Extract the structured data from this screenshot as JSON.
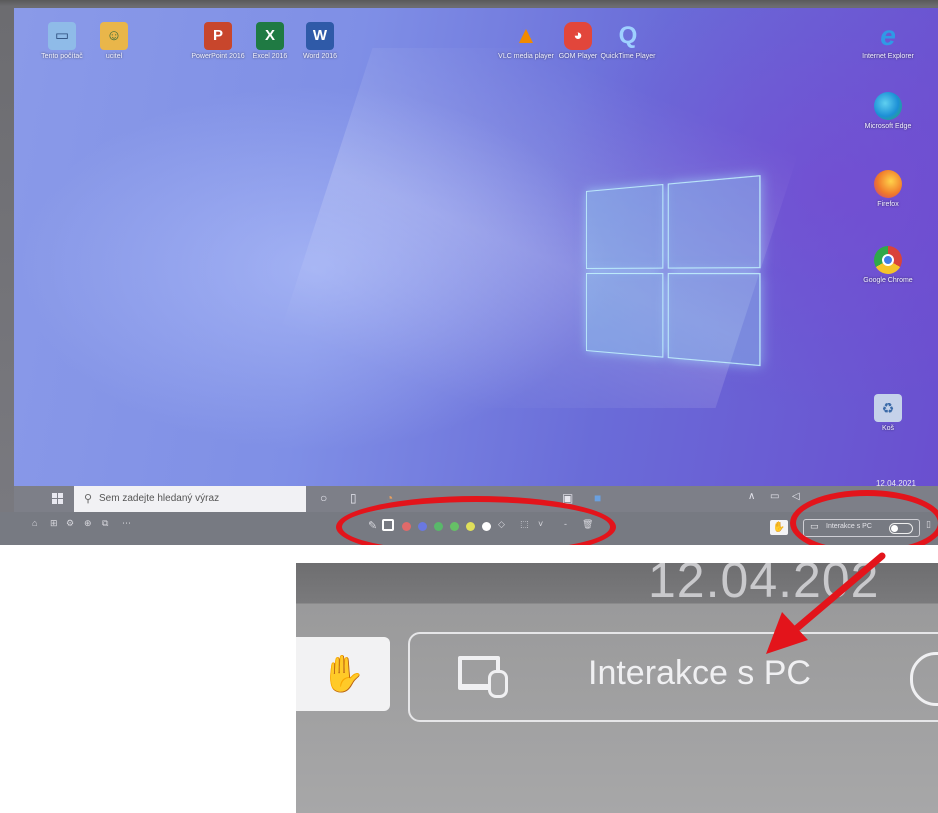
{
  "desktop": {
    "icons": [
      {
        "name": "this-pc",
        "label": "Tento počítač",
        "color": "#7fb2e6",
        "glyph": "▭"
      },
      {
        "name": "user-folder",
        "label": "ucitel",
        "color": "#e9b64a",
        "glyph": "👤"
      },
      {
        "name": "powerpoint",
        "label": "PowerPoint 2016",
        "color": "#c8462c",
        "glyph": "P"
      },
      {
        "name": "excel",
        "label": "Excel 2016",
        "color": "#1f7a43",
        "glyph": "X"
      },
      {
        "name": "word",
        "label": "Word 2016",
        "color": "#2f5aa8",
        "glyph": "W"
      },
      {
        "name": "vlc",
        "label": "VLC media player",
        "color": "#f08a00",
        "glyph": "▲"
      },
      {
        "name": "gom-player",
        "label": "GOM Player",
        "color": "#e2463b",
        "glyph": "●"
      },
      {
        "name": "quicktime",
        "label": "QuickTime Player",
        "color": "#4aa4e8",
        "glyph": "Q"
      },
      {
        "name": "internet-explorer",
        "label": "Internet Explorer",
        "color": "#2f88d6",
        "glyph": "e"
      },
      {
        "name": "microsoft-edge",
        "label": "Microsoft Edge",
        "color": "#2fa86a",
        "glyph": "◐"
      },
      {
        "name": "firefox",
        "label": "Firefox",
        "color": "#e8702a",
        "glyph": "◉"
      },
      {
        "name": "google-chrome",
        "label": "Google Chrome",
        "color": "#d9433a",
        "glyph": "◎"
      },
      {
        "name": "recycle-bin",
        "label": "Koš",
        "color": "#b7c7e6",
        "glyph": "♻"
      }
    ]
  },
  "taskbar": {
    "search_placeholder": "Sem zadejte hledaný výraz",
    "date": "12.04.2021"
  },
  "toolbar": {
    "colors": [
      "#ffffff",
      "#e06a6a",
      "#6a78e0",
      "#59b86a",
      "#66c066",
      "#e0e05a",
      "#ffffff"
    ]
  },
  "interaction": {
    "label": "Interakce s PC"
  },
  "zoom": {
    "date_fragment": "12.04.202",
    "label": "Interakce s PC"
  },
  "annotation_color": "#e3141b"
}
